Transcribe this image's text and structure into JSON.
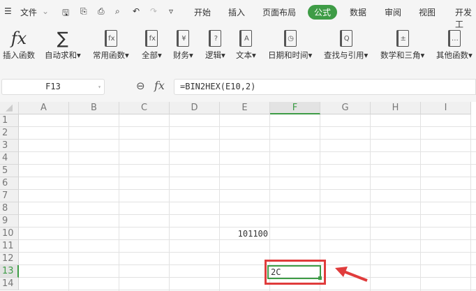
{
  "menu": {
    "file": "文件",
    "tabs": [
      "开始",
      "插入",
      "页面布局",
      "公式",
      "数据",
      "审阅",
      "视图",
      "开发工"
    ],
    "active_tab": "公式"
  },
  "ribbon": [
    {
      "label": "插入函数",
      "icon": "fx"
    },
    {
      "label": "自动求和▾",
      "icon": "∑"
    },
    {
      "label": "常用函数▾",
      "icon": "fx☆"
    },
    {
      "label": "全部▾",
      "icon": "fx"
    },
    {
      "label": "财务▾",
      "icon": "¥"
    },
    {
      "label": "逻辑▾",
      "icon": "?"
    },
    {
      "label": "文本▾",
      "icon": "A"
    },
    {
      "label": "日期和时间▾",
      "icon": "◷"
    },
    {
      "label": "查找与引用▾",
      "icon": "Q"
    },
    {
      "label": "数学和三角▾",
      "icon": "+-"
    },
    {
      "label": "其他函数▾",
      "icon": "···"
    }
  ],
  "formula_bar": {
    "cell": "F13",
    "fx": "fx",
    "formula": "=BIN2HEX(E10,2)"
  },
  "columns": [
    "A",
    "B",
    "C",
    "D",
    "E",
    "F",
    "G",
    "H",
    "I"
  ],
  "rows": [
    "1",
    "2",
    "3",
    "4",
    "5",
    "6",
    "7",
    "8",
    "9",
    "10",
    "11",
    "12",
    "13",
    "14"
  ],
  "cells": {
    "E10": "101100",
    "F13": "2C"
  },
  "colors": {
    "accent": "#3e9c46",
    "annotation": "#e03c3c"
  }
}
